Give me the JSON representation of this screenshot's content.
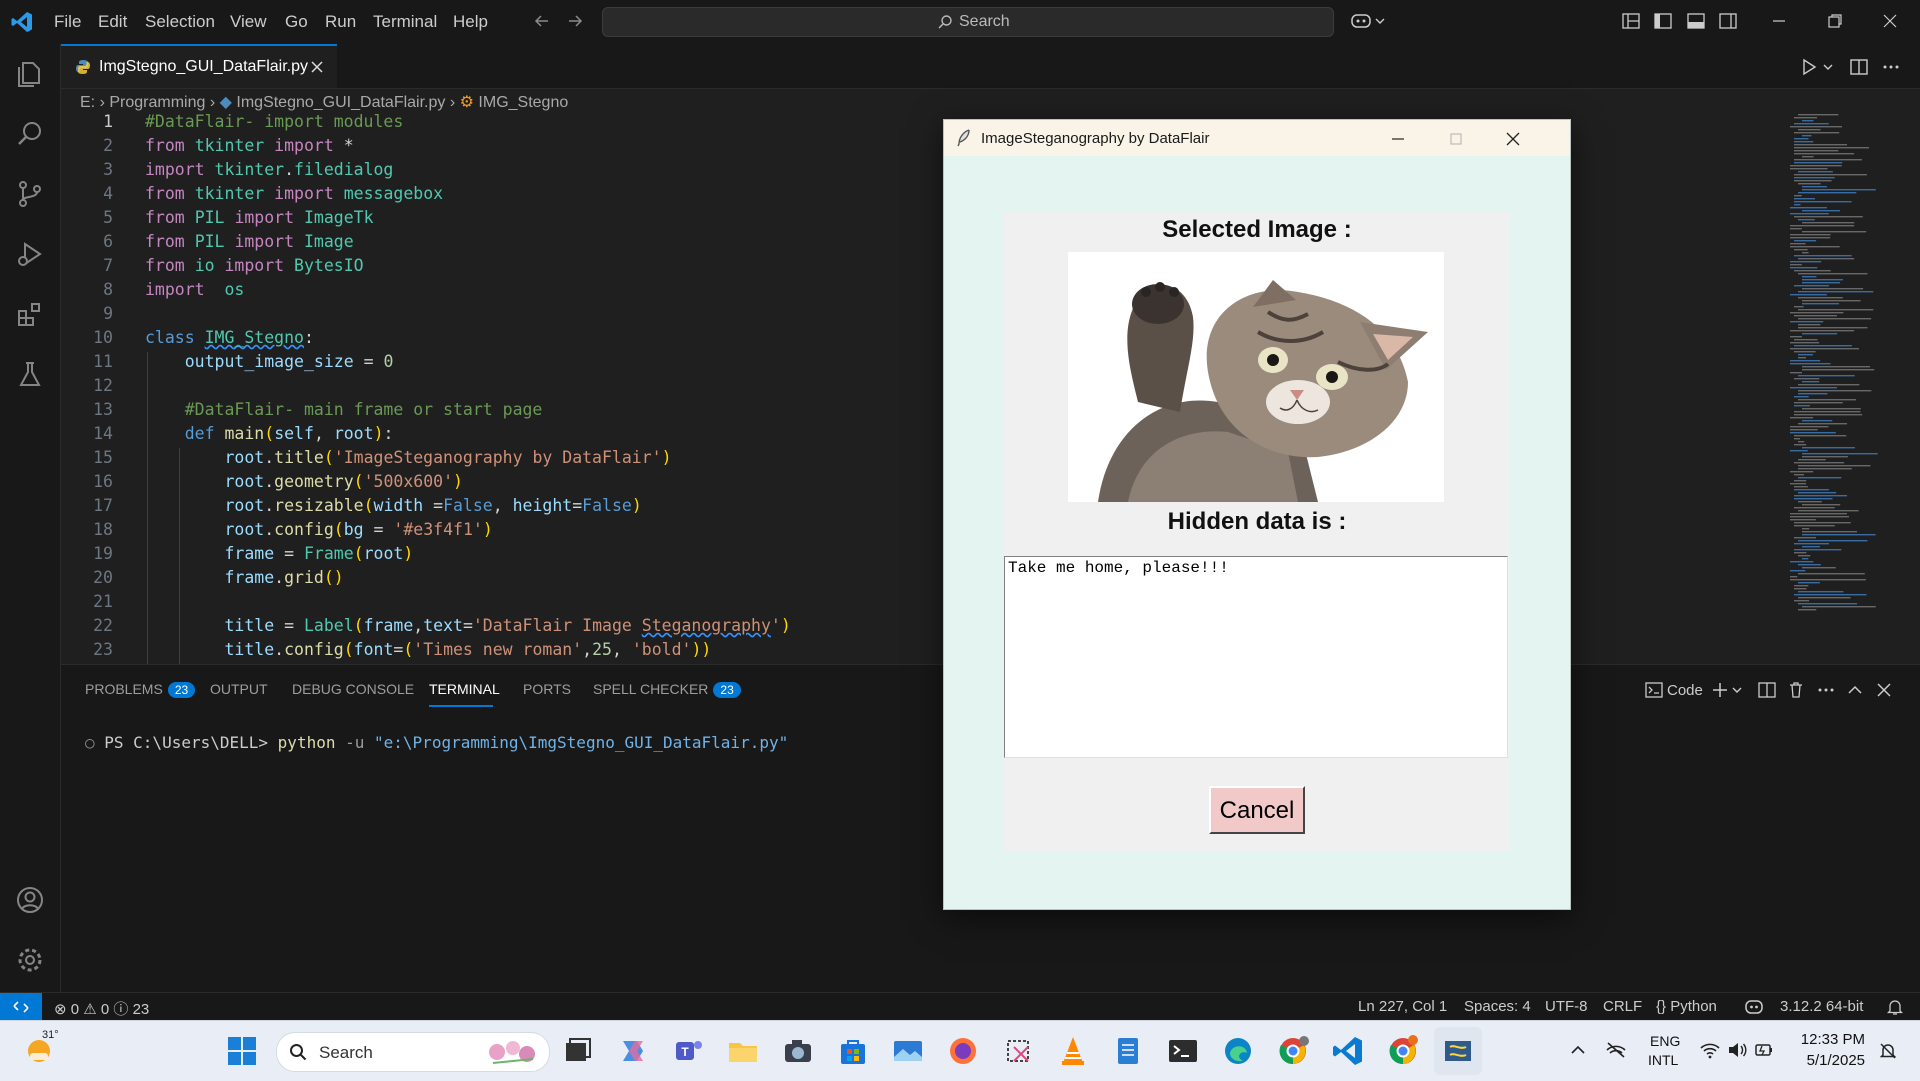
{
  "menu": [
    "File",
    "Edit",
    "Selection",
    "View",
    "Go",
    "Run",
    "Terminal",
    "Help"
  ],
  "search": {
    "label": "Search"
  },
  "tab": {
    "title": "ImgStegno_GUI_DataFlair.py"
  },
  "breadcrumb": {
    "drive": "E:",
    "folder": "Programming",
    "file": "ImgStegno_GUI_DataFlair.py",
    "symbol": "IMG_Stegno"
  },
  "code_lines": [
    {
      "n": "1",
      "tokens": [
        [
          "cm",
          "#DataFlair- import modules"
        ]
      ]
    },
    {
      "n": "2",
      "tokens": [
        [
          "kc",
          "from"
        ],
        [
          "pl",
          " "
        ],
        [
          "cls",
          "tkinter"
        ],
        [
          "pl",
          " "
        ],
        [
          "kc",
          "import"
        ],
        [
          "pl",
          " *"
        ]
      ]
    },
    {
      "n": "3",
      "tokens": [
        [
          "kc",
          "import"
        ],
        [
          "pl",
          " "
        ],
        [
          "cls",
          "tkinter"
        ],
        [
          "pl",
          "."
        ],
        [
          "cls",
          "filedialog"
        ]
      ]
    },
    {
      "n": "4",
      "tokens": [
        [
          "kc",
          "from"
        ],
        [
          "pl",
          " "
        ],
        [
          "cls",
          "tkinter"
        ],
        [
          "pl",
          " "
        ],
        [
          "kc",
          "import"
        ],
        [
          "pl",
          " "
        ],
        [
          "cls",
          "messagebox"
        ]
      ]
    },
    {
      "n": "5",
      "tokens": [
        [
          "kc",
          "from"
        ],
        [
          "pl",
          " "
        ],
        [
          "cls",
          "PIL"
        ],
        [
          "pl",
          " "
        ],
        [
          "kc",
          "import"
        ],
        [
          "pl",
          " "
        ],
        [
          "cls",
          "ImageTk"
        ]
      ]
    },
    {
      "n": "6",
      "tokens": [
        [
          "kc",
          "from"
        ],
        [
          "pl",
          " "
        ],
        [
          "cls",
          "PIL"
        ],
        [
          "pl",
          " "
        ],
        [
          "kc",
          "import"
        ],
        [
          "pl",
          " "
        ],
        [
          "cls",
          "Image"
        ]
      ]
    },
    {
      "n": "7",
      "tokens": [
        [
          "kc",
          "from"
        ],
        [
          "pl",
          " "
        ],
        [
          "cls",
          "io"
        ],
        [
          "pl",
          " "
        ],
        [
          "kc",
          "import"
        ],
        [
          "pl",
          " "
        ],
        [
          "cls",
          "BytesIO"
        ]
      ]
    },
    {
      "n": "8",
      "tokens": [
        [
          "kc",
          "import"
        ],
        [
          "pl",
          "  "
        ],
        [
          "cls",
          "os"
        ]
      ]
    },
    {
      "n": "9",
      "tokens": []
    },
    {
      "n": "10",
      "tokens": [
        [
          "kw",
          "class"
        ],
        [
          "pl",
          " "
        ],
        [
          "cls sq",
          "IMG_Stegno"
        ],
        [
          "pl",
          ":"
        ]
      ]
    },
    {
      "n": "11",
      "tokens": [
        [
          "pl",
          "    "
        ],
        [
          "va",
          "output_image_size"
        ],
        [
          "pl",
          " = "
        ],
        [
          "nu",
          "0"
        ]
      ]
    },
    {
      "n": "12",
      "tokens": []
    },
    {
      "n": "13",
      "tokens": [
        [
          "pl",
          "    "
        ],
        [
          "cm",
          "#DataFlair- main frame or start page"
        ]
      ]
    },
    {
      "n": "14",
      "tokens": [
        [
          "pl",
          "    "
        ],
        [
          "kw",
          "def"
        ],
        [
          "pl",
          " "
        ],
        [
          "fn",
          "main"
        ],
        [
          "pa",
          "("
        ],
        [
          "va",
          "self"
        ],
        [
          "pl",
          ", "
        ],
        [
          "va",
          "root"
        ],
        [
          "pa",
          ")"
        ],
        [
          "pl",
          ":"
        ]
      ]
    },
    {
      "n": "15",
      "tokens": [
        [
          "pl",
          "        "
        ],
        [
          "va",
          "root"
        ],
        [
          "pl",
          "."
        ],
        [
          "fn",
          "title"
        ],
        [
          "pa",
          "("
        ],
        [
          "st",
          "'ImageSteganography by DataFlair'"
        ],
        [
          "pa",
          ")"
        ]
      ]
    },
    {
      "n": "16",
      "tokens": [
        [
          "pl",
          "        "
        ],
        [
          "va",
          "root"
        ],
        [
          "pl",
          "."
        ],
        [
          "fn",
          "geometry"
        ],
        [
          "pa",
          "("
        ],
        [
          "st",
          "'500x600'"
        ],
        [
          "pa",
          ")"
        ]
      ]
    },
    {
      "n": "17",
      "tokens": [
        [
          "pl",
          "        "
        ],
        [
          "va",
          "root"
        ],
        [
          "pl",
          "."
        ],
        [
          "fn",
          "resizable"
        ],
        [
          "pa",
          "("
        ],
        [
          "va",
          "width"
        ],
        [
          "pl",
          " ="
        ],
        [
          "kw",
          "False"
        ],
        [
          "pl",
          ", "
        ],
        [
          "va",
          "height"
        ],
        [
          "pl",
          "="
        ],
        [
          "kw",
          "False"
        ],
        [
          "pa",
          ")"
        ]
      ]
    },
    {
      "n": "18",
      "tokens": [
        [
          "pl",
          "        "
        ],
        [
          "va",
          "root"
        ],
        [
          "pl",
          "."
        ],
        [
          "fn",
          "config"
        ],
        [
          "pa",
          "("
        ],
        [
          "va",
          "bg"
        ],
        [
          "pl",
          " = "
        ],
        [
          "st",
          "'#e3f4f1'"
        ],
        [
          "pa",
          ")"
        ]
      ]
    },
    {
      "n": "19",
      "tokens": [
        [
          "pl",
          "        "
        ],
        [
          "va",
          "frame"
        ],
        [
          "pl",
          " = "
        ],
        [
          "cls",
          "Frame"
        ],
        [
          "pa",
          "("
        ],
        [
          "va",
          "root"
        ],
        [
          "pa",
          ")"
        ]
      ]
    },
    {
      "n": "20",
      "tokens": [
        [
          "pl",
          "        "
        ],
        [
          "va",
          "frame"
        ],
        [
          "pl",
          "."
        ],
        [
          "fn",
          "grid"
        ],
        [
          "pa",
          "()"
        ]
      ]
    },
    {
      "n": "21",
      "tokens": []
    },
    {
      "n": "22",
      "tokens": [
        [
          "pl",
          "        "
        ],
        [
          "va",
          "title"
        ],
        [
          "pl",
          " = "
        ],
        [
          "cls",
          "Label"
        ],
        [
          "pa",
          "("
        ],
        [
          "va",
          "frame"
        ],
        [
          "pl",
          ","
        ],
        [
          "va",
          "text"
        ],
        [
          "pl",
          "="
        ],
        [
          "st",
          "'DataFlair Image "
        ],
        [
          "st sq",
          "Steganography"
        ],
        [
          "st",
          "'"
        ],
        [
          "pa",
          ")"
        ]
      ]
    },
    {
      "n": "23",
      "tokens": [
        [
          "pl",
          "        "
        ],
        [
          "va",
          "title"
        ],
        [
          "pl",
          "."
        ],
        [
          "fn",
          "config"
        ],
        [
          "pa",
          "("
        ],
        [
          "va",
          "font"
        ],
        [
          "pl",
          "="
        ],
        [
          "pa",
          "("
        ],
        [
          "st",
          "'Times new roman'"
        ],
        [
          "pl",
          ","
        ],
        [
          "nu",
          "25"
        ],
        [
          "pl",
          ", "
        ],
        [
          "st",
          "'bold'"
        ],
        [
          "pa",
          "))"
        ]
      ]
    }
  ],
  "panel": {
    "tabs": [
      {
        "label": "PROBLEMS",
        "badge": "23"
      },
      {
        "label": "OUTPUT",
        "badge": ""
      },
      {
        "label": "DEBUG CONSOLE",
        "badge": ""
      },
      {
        "label": "TERMINAL",
        "badge": ""
      },
      {
        "label": "PORTS",
        "badge": ""
      },
      {
        "label": "SPELL CHECKER",
        "badge": "23"
      }
    ],
    "terminal_shell": "Code",
    "prompt": "PS C:\\Users\\DELL>",
    "command": "python",
    "flag": "-u",
    "arg": "\"e:\\Programming\\ImgStegno_GUI_DataFlair.py\""
  },
  "statusbar": {
    "errors": "0",
    "warnings": "0",
    "info": "23",
    "position": "Ln 227, Col 1",
    "spaces": "Spaces: 4",
    "encoding": "UTF-8",
    "eol": "CRLF",
    "language": "Python",
    "interpreter": "3.12.2 64-bit"
  },
  "tkwindow": {
    "title": "ImageSteganography by DataFlair",
    "selected_label": "Selected Image :",
    "hidden_label": "Hidden data is :",
    "hidden_text": "Take me home, please!!!",
    "cancel": "Cancel",
    "bg": "#e3f4f1"
  },
  "taskbar": {
    "weather": "31°",
    "search": "Search",
    "lang1": "ENG",
    "lang2": "INTL",
    "time": "12:33 PM",
    "date": "5/1/2025"
  },
  "colors": {
    "accent": "#0078d4",
    "editor_bg": "#1f1f1f"
  }
}
